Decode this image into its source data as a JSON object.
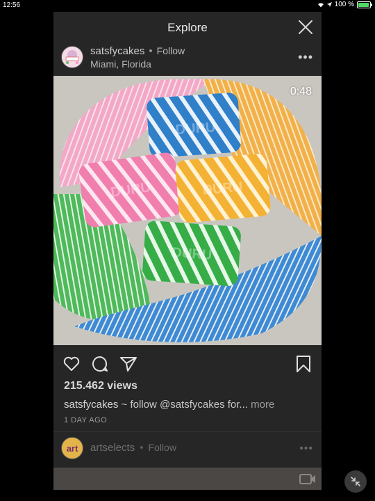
{
  "status_bar": {
    "time": "12:56",
    "battery_text": "100 %"
  },
  "header": {
    "title": "Explore"
  },
  "post": {
    "username": "satsfycakes",
    "follow_label": "Follow",
    "location": "Miami, Florida",
    "duration": "0:48",
    "views": "215.462 views",
    "caption_user": "satsfycakes",
    "caption_text": " ~ follow @satsfycakes for...",
    "caption_more": "more",
    "time_ago": "1 DAY AGO",
    "soap_text": "DURU"
  },
  "next_post": {
    "username": "artselects",
    "follow_label": "Follow"
  },
  "icons": {
    "close": "close-icon",
    "more": "more-options-icon",
    "like": "heart-icon",
    "comment": "comment-icon",
    "share": "send-icon",
    "save": "bookmark-icon",
    "video": "video-camera-icon",
    "minimize": "minimize-icon"
  },
  "colors": {
    "panel": "#262626",
    "soap_blue": "#2f7fc9",
    "soap_pink": "#f08bb3",
    "soap_yellow": "#f3b43c",
    "soap_green": "#3fb54e"
  }
}
